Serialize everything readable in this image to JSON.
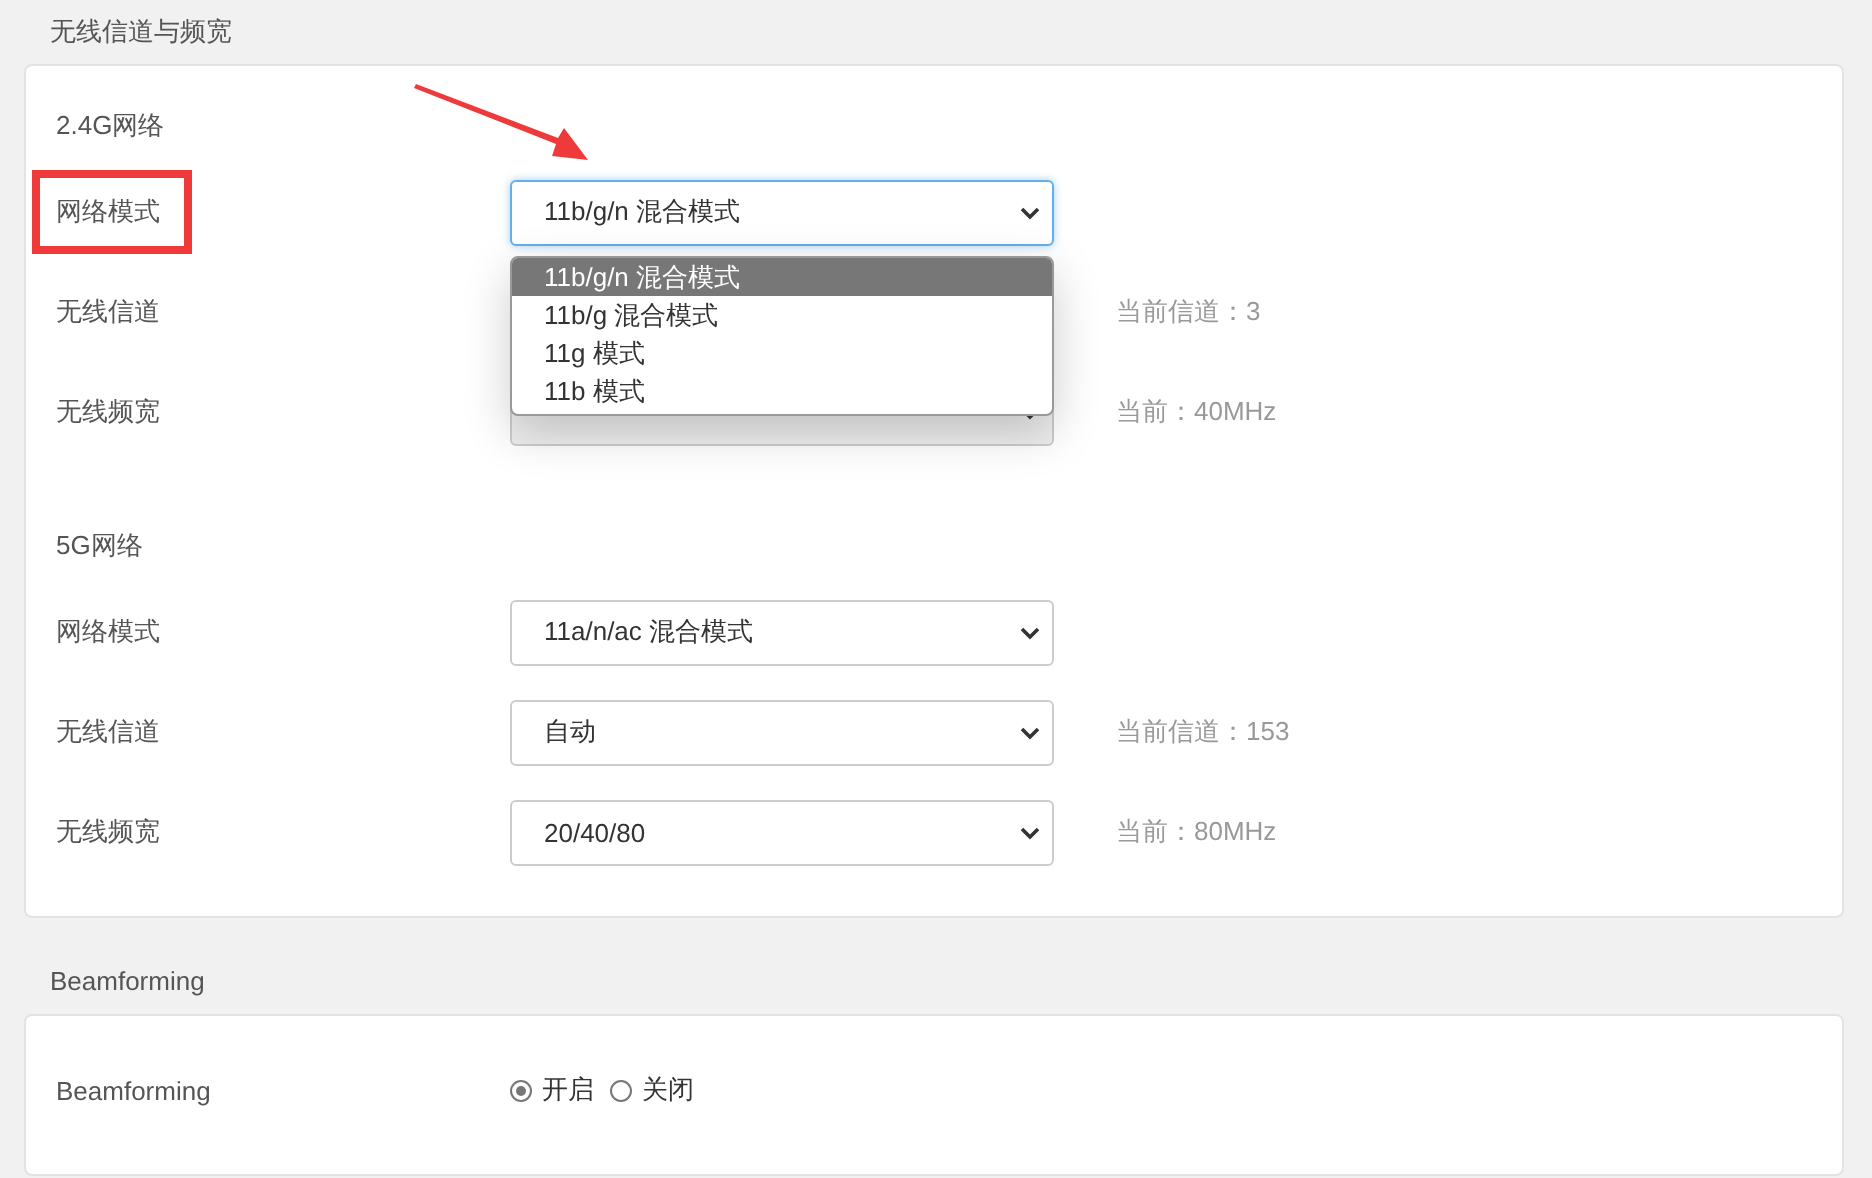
{
  "sections": [
    {
      "title": "无线信道与频宽",
      "groups": [
        {
          "heading": "2.4G网络",
          "rows": [
            {
              "label": "网络模式",
              "highlighted": true,
              "select": {
                "value": "11b/g/n 混合模式",
                "focused": true,
                "disabled": false,
                "options": [
                  {
                    "label": "11b/g/n 混合模式",
                    "selected": true
                  },
                  {
                    "label": "11b/g 混合模式",
                    "selected": false
                  },
                  {
                    "label": "11g 模式",
                    "selected": false
                  },
                  {
                    "label": "11b 模式",
                    "selected": false
                  }
                ]
              }
            },
            {
              "label": "无线信道",
              "highlighted": false,
              "note": "当前信道：3"
            },
            {
              "label": "无线频宽",
              "highlighted": false,
              "select": {
                "focused": false,
                "disabled": true
              },
              "note": "当前：40MHz"
            }
          ]
        },
        {
          "heading": "5G网络",
          "rows": [
            {
              "label": "网络模式",
              "highlighted": false,
              "select": {
                "value": "11a/n/ac 混合模式",
                "focused": false,
                "disabled": false
              }
            },
            {
              "label": "无线信道",
              "highlighted": false,
              "select": {
                "value": "自动",
                "focused": false,
                "disabled": false
              },
              "note": "当前信道：153"
            },
            {
              "label": "无线频宽",
              "highlighted": false,
              "select": {
                "value": "20/40/80",
                "focused": false,
                "disabled": false
              },
              "note": "当前：80MHz"
            }
          ]
        }
      ]
    },
    {
      "title": "Beamforming",
      "groups": [
        {
          "rows": [
            {
              "label": "Beamforming",
              "highlighted": false,
              "radios": [
                {
                  "label": "开启",
                  "selected": true
                },
                {
                  "label": "关闭",
                  "selected": false
                }
              ]
            }
          ]
        }
      ]
    }
  ]
}
